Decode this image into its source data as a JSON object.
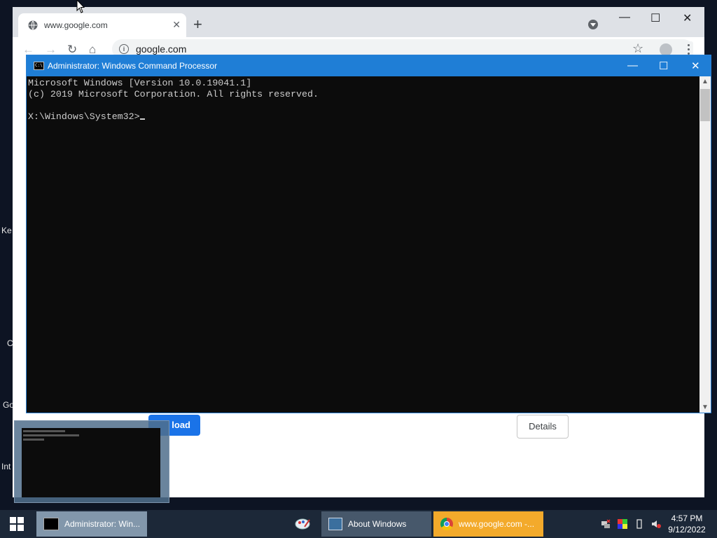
{
  "desktop": {
    "labels": [
      "Ke",
      "C",
      "Go",
      "Int"
    ]
  },
  "chrome": {
    "tab_title": "www.google.com",
    "url": "google.com",
    "reload_label": "load",
    "details_label": "Details",
    "window_controls": {
      "minimize": "—",
      "maximize": "☐",
      "close": "✕"
    }
  },
  "cmd": {
    "title": "Administrator: Windows Command Processor",
    "icon_text": "C:\\",
    "lines": [
      "Microsoft Windows [Version 10.0.19041.1]",
      "(c) 2019 Microsoft Corporation. All rights reserved.",
      "",
      "X:\\Windows\\System32>"
    ],
    "window_controls": {
      "minimize": "—",
      "maximize": "☐",
      "close": "✕"
    }
  },
  "taskbar": {
    "items": [
      {
        "label": "Administrator: Win...",
        "icon": "cmd-icon"
      },
      {
        "label": "",
        "icon": "paint-icon"
      },
      {
        "label": "About Windows",
        "icon": "about-windows-icon"
      },
      {
        "label": "www.google.com -...",
        "icon": "chrome-icon"
      }
    ],
    "time": "4:57 PM",
    "date": "9/12/2022"
  }
}
